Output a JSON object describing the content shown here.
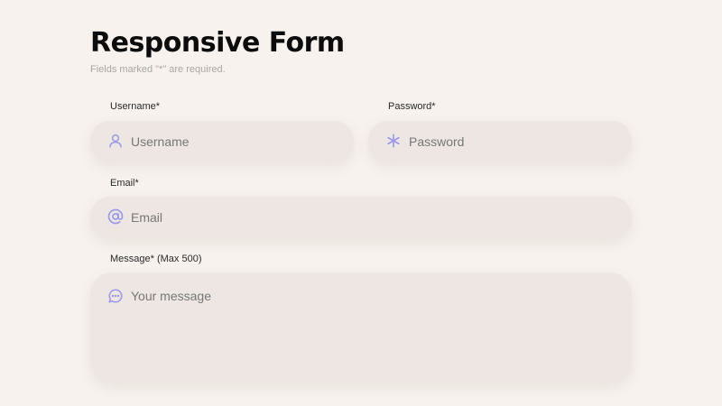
{
  "form": {
    "title": "Responsive Form",
    "subtitle": "Fields marked \"*\" are required.",
    "accent_color": "#9b97ea",
    "fields": {
      "username": {
        "label": "Username*",
        "placeholder": "Username",
        "value": "",
        "icon": "user-icon"
      },
      "password": {
        "label": "Password*",
        "placeholder": "Password",
        "value": "",
        "icon": "asterisk-icon"
      },
      "email": {
        "label": "Email*",
        "placeholder": "Email",
        "value": "",
        "icon": "at-sign-icon"
      },
      "message": {
        "label": "Message* (Max 500)",
        "placeholder": "Your message",
        "value": "",
        "icon": "chat-bubble-icon"
      }
    }
  }
}
